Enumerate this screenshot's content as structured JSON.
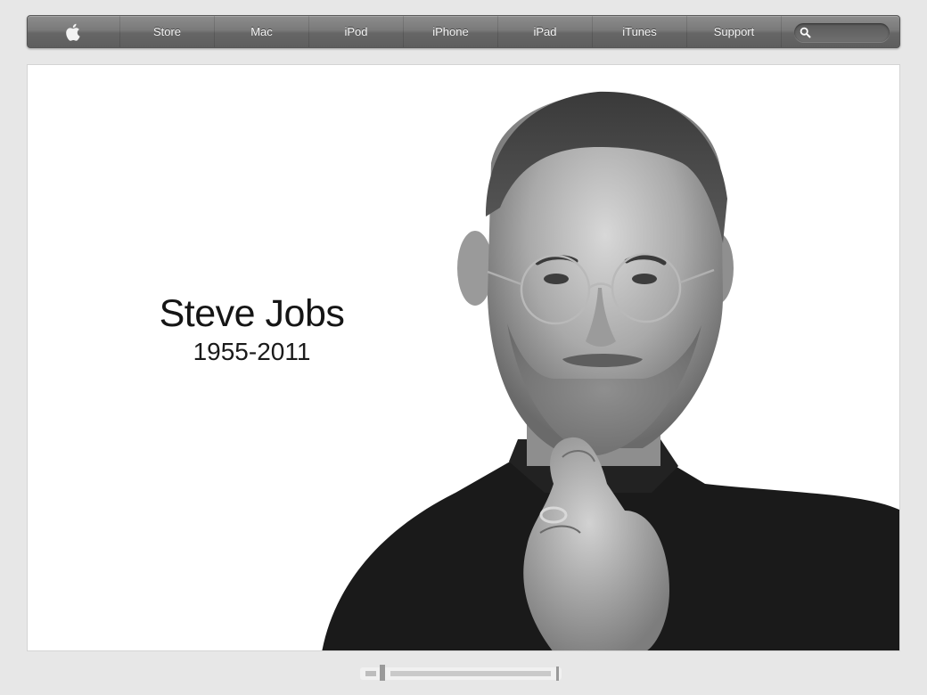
{
  "nav": {
    "logo_icon": "apple-icon",
    "items": [
      {
        "label": "Store"
      },
      {
        "label": "Mac"
      },
      {
        "label": "iPod"
      },
      {
        "label": "iPhone"
      },
      {
        "label": "iPad"
      },
      {
        "label": "iTunes"
      },
      {
        "label": "Support"
      }
    ],
    "search": {
      "icon": "search-icon",
      "placeholder": "",
      "value": ""
    }
  },
  "hero": {
    "name": "Steve Jobs",
    "years": "1955-2011"
  },
  "colors": {
    "page_background": "#e7e7e7",
    "nav_top": "#8c8c8c",
    "nav_bottom": "#5e5e5e",
    "hero_background": "#ffffff",
    "text": "#151515"
  }
}
